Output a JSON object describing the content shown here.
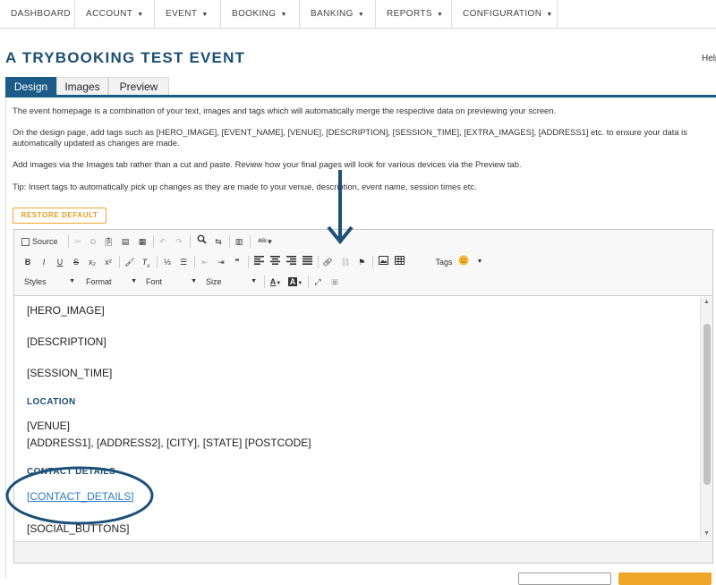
{
  "nav": {
    "items": [
      {
        "label": "DASHBOARD",
        "caret": false
      },
      {
        "label": "ACCOUNT",
        "caret": true
      },
      {
        "label": "EVENT",
        "caret": true
      },
      {
        "label": "BOOKING",
        "caret": true
      },
      {
        "label": "BANKING",
        "caret": true
      },
      {
        "label": "REPORTS",
        "caret": true
      },
      {
        "label": "CONFIGURATION",
        "caret": true
      }
    ]
  },
  "page": {
    "title": "A TRYBOOKING TEST EVENT",
    "help": "Help"
  },
  "tabs": [
    {
      "label": "Design",
      "active": true
    },
    {
      "label": "Images",
      "active": false
    },
    {
      "label": "Preview",
      "active": false
    }
  ],
  "intro": {
    "p1": "The event homepage is a combination of your text, images and tags which will automatically merge the respective data on previewing your screen.",
    "p2": "On the design page, add tags such as [HERO_IMAGE], [EVENT_NAME], [VENUE], [DESCRIPTION], [SESSION_TIME], [EXTRA_IMAGES], [ADDRESS1] etc. to ensure your data is automatically updated as changes are made.",
    "p3": "Add images via the Images tab rather than a cut and paste. Review how your final pages will look for various devices via the Preview tab.",
    "p4": "Tip: Insert tags to automatically pick up changes as they are made to your venue, description, event name, session times etc."
  },
  "restore_default": "RESTORE DEFAULT",
  "toolbar": {
    "source": "Source",
    "tags": "Tags",
    "styles": "Styles",
    "format": "Format",
    "font": "Font",
    "size": "Size"
  },
  "editor": {
    "hero": "[HERO_IMAGE]",
    "description": "[DESCRIPTION]",
    "session_time": "[SESSION_TIME]",
    "location_heading": "LOCATION",
    "venue": "[VENUE]",
    "address": "[ADDRESS1], [ADDRESS2], [CITY], [STATE] [POSTCODE]",
    "contact_heading": "CONTACT DETAILS",
    "contact_details": "[CONTACT_DETAILS]",
    "social": "[SOCIAL_BUTTONS]"
  },
  "colors": {
    "brand_blue": "#1c5a88",
    "title_blue": "#1c4f72",
    "annotation": "#1e4f78",
    "accent_orange": "#f0a529",
    "link_blue": "#2a7bbf"
  }
}
